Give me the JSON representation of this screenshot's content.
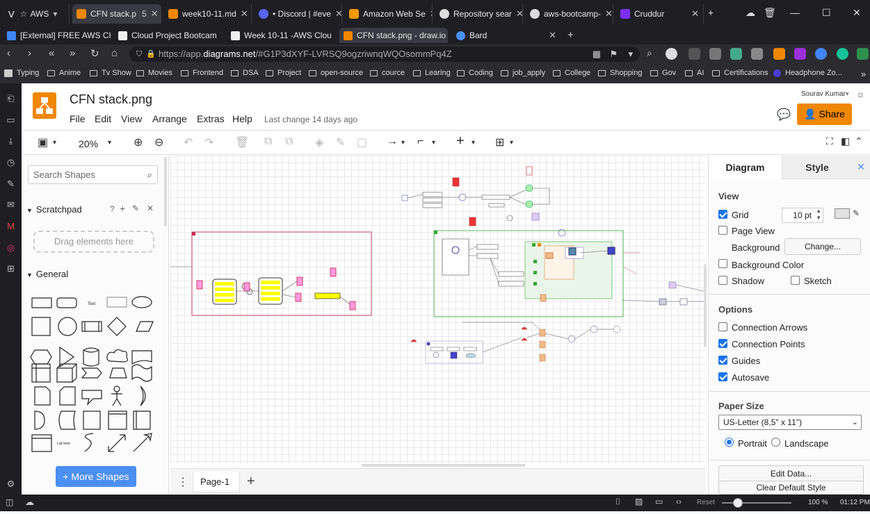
{
  "browser": {
    "tabs_row1": [
      {
        "label": "AWS",
        "color": "#3c3c44"
      },
      {
        "label": "CFN stack.p",
        "badge": "5",
        "color": "#f08705"
      },
      {
        "label": "week10-11.md",
        "color": "#f08705"
      },
      {
        "label": "• Discord | #eve",
        "color": "#5865f2"
      },
      {
        "label": "Amazon Web Se",
        "color": "#ff9900"
      },
      {
        "label": "Repository sear",
        "color": "#555"
      },
      {
        "label": "aws-bootcamp-",
        "color": "#555"
      },
      {
        "label": "Cruddur",
        "color": "#7b2ff7"
      }
    ],
    "tabs_row2": [
      {
        "label": "[External] FREE AWS Clo",
        "color": "#4285f4"
      },
      {
        "label": "Cloud Project Bootcam",
        "color": "#fff"
      },
      {
        "label": "Week 10-11 -AWS Clou",
        "color": "#fff"
      },
      {
        "label": "CFN stack.png - draw.io",
        "color": "#f08705"
      },
      {
        "label": "Bard",
        "color": "#4b8ff0"
      }
    ],
    "url_prefix": "https://app.",
    "url_domain": "diagrams.net",
    "url_rest": "/#G1P3dXYF-LVRSQ9ogzriwnqWQOsommPq4Z",
    "bookmarks": [
      "Typing",
      "Anime",
      "Tv Show",
      "Movies",
      "Frontend",
      "DSA",
      "Project",
      "open-source",
      "cource",
      "Learing",
      "Coding",
      "job_apply",
      "College",
      "Shopping",
      "Gov",
      "AI",
      "Certifications",
      "Headphone Zo..."
    ],
    "status": {
      "reset": "Reset",
      "zoom": "100 %",
      "time": "01:12 PM"
    }
  },
  "drawio": {
    "doc_title": "CFN stack.png",
    "menu": [
      "File",
      "Edit",
      "View",
      "Arrange",
      "Extras",
      "Help"
    ],
    "last_change": "Last change 14 days ago",
    "user": "Sourav Kumar",
    "share": "Share",
    "zoom": "20%",
    "search_placeholder": "Search Shapes",
    "scratchpad": "Scratchpad",
    "drag_hint": "Drag elements here",
    "general": "General",
    "more_shapes": "+ More Shapes",
    "page_tab": "Page-1",
    "right": {
      "tab_diagram": "Diagram",
      "tab_style": "Style",
      "view_title": "View",
      "grid": "Grid",
      "grid_size": "10 pt",
      "page_view": "Page View",
      "background": "Background",
      "change": "Change...",
      "background_color": "Background Color",
      "shadow": "Shadow",
      "sketch": "Sketch",
      "options_title": "Options",
      "connection_arrows": "Connection Arrows",
      "connection_points": "Connection Points",
      "guides": "Guides",
      "autosave": "Autosave",
      "paper_size_title": "Paper Size",
      "paper_size": "US-Letter (8,5\" x 11\")",
      "portrait": "Portrait",
      "landscape": "Landscape",
      "edit_data": "Edit Data...",
      "clear_style": "Clear Default Style"
    }
  }
}
